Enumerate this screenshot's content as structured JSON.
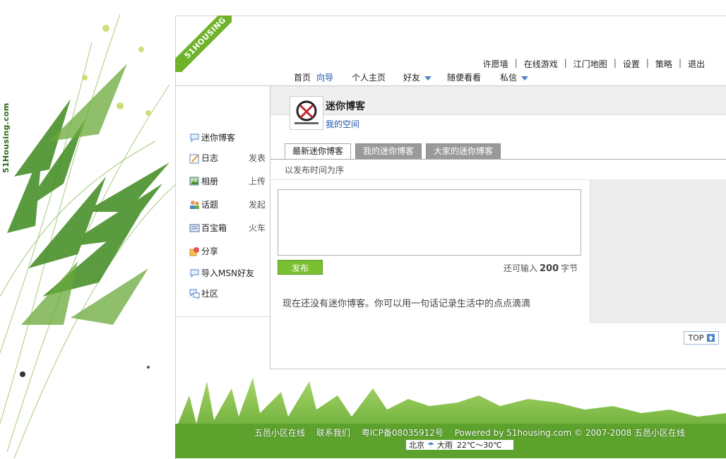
{
  "brand": {
    "vertical_text": "51Housing.com",
    "ribbon_text": "51HOUSING"
  },
  "top_links": [
    "许愿墙",
    "在线游戏",
    "江门地图",
    "设置",
    "策略",
    "退出"
  ],
  "main_nav": {
    "home": "首页",
    "guide": "向导",
    "personal": "个人主页",
    "friends": "好友",
    "browse": "随便看看",
    "messages": "私信"
  },
  "sidebar": {
    "items": [
      {
        "label": "迷你博客",
        "action": "",
        "icon": "chat-bubble-icon"
      },
      {
        "label": "日志",
        "action": "发表",
        "icon": "pencil-note-icon"
      },
      {
        "label": "相册",
        "action": "上传",
        "icon": "photo-icon"
      },
      {
        "label": "话题",
        "action": "发起",
        "icon": "people-icon"
      },
      {
        "label": "百宝箱",
        "action": "火车",
        "icon": "toolbox-icon"
      },
      {
        "label": "分享",
        "action": "",
        "icon": "share-icon"
      },
      {
        "label": "导入MSN好友",
        "action": "",
        "icon": "chat-bubble-icon"
      },
      {
        "label": "社区",
        "action": "",
        "icon": "community-icon"
      }
    ]
  },
  "content": {
    "title": "迷你博客",
    "my_space": "我的空间",
    "tabs": [
      {
        "label": "最新迷你博客",
        "active": true
      },
      {
        "label": "我的迷你博客",
        "active": false
      },
      {
        "label": "大家的迷你博客",
        "active": false
      }
    ],
    "sort_note": "以发布时间为序",
    "post_button": "发布",
    "remain_prefix": "还可输入",
    "remain_count": "200",
    "remain_suffix": "字节",
    "empty_message": "现在还没有迷你博客。你可以用一句话记录生活中的点点滴滴",
    "top_label": "TOP"
  },
  "footer": {
    "site": "五邑小区在线",
    "contact": "联系我们",
    "icp": "粤ICP备08035912号",
    "powered": "Powered by 51housing.com © 2007-2008 五邑小区在线"
  },
  "weather": {
    "city": "北京",
    "condition": "大雨",
    "temp": "22℃～30℃"
  },
  "colors": {
    "accent_green": "#7bbf32",
    "link_blue": "#2255aa",
    "tab_gray": "#9a9a9a"
  }
}
